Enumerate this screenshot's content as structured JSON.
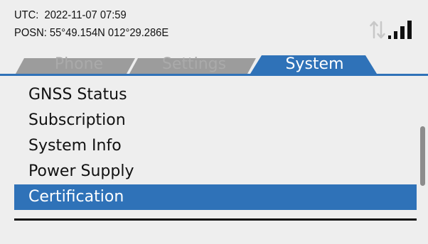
{
  "status": {
    "utc": "UTC:  2022-11-07 07:59",
    "posn": "POSN: 55°49.154N 012°29.286E",
    "icons": {
      "traffic": "up-down-arrows-icon",
      "signal": "signal-bars-icon"
    }
  },
  "tabs": [
    {
      "label": "Phone",
      "active": false
    },
    {
      "label": "Settings",
      "active": false
    },
    {
      "label": "System",
      "active": true
    }
  ],
  "menu": {
    "items": [
      {
        "label": "GNSS Status",
        "selected": false
      },
      {
        "label": "Subscription",
        "selected": false
      },
      {
        "label": "System Info",
        "selected": false
      },
      {
        "label": "Power Supply",
        "selected": false
      },
      {
        "label": "Certification",
        "selected": true
      }
    ]
  },
  "colors": {
    "accent": "#2f72b8",
    "inactive_tab": "#9c9c9c",
    "background": "#eeeeee"
  }
}
